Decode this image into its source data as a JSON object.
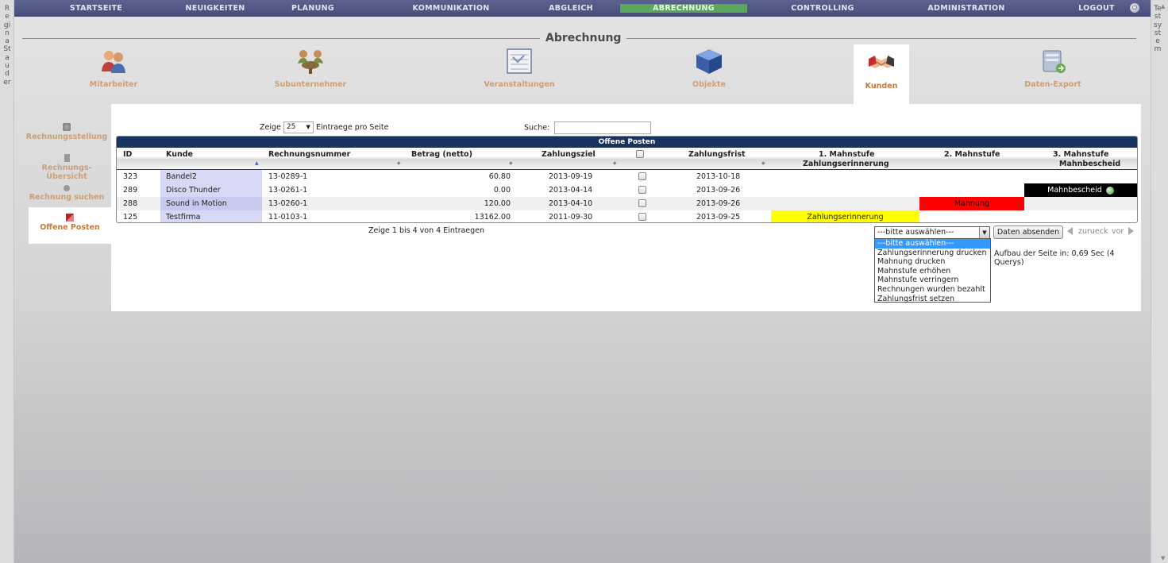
{
  "side": {
    "left_text": "Regina Stauder",
    "right_text": "Testsystem"
  },
  "nav": {
    "items": [
      "STARTSEITE",
      "NEUIGKEITEN",
      "PLANUNG",
      "KOMMUNIKATION",
      "ABGLEICH",
      "ABRECHNUNG",
      "CONTROLLING",
      "ADMINISTRATION",
      "LOGOUT"
    ],
    "active": "ABRECHNUNG",
    "active_color": "#5aa65a"
  },
  "section": {
    "title": "Abrechnung"
  },
  "modules": [
    {
      "label": "Mitarbeiter",
      "icon": "people-icon"
    },
    {
      "label": "Subunternehmer",
      "icon": "meeting-icon"
    },
    {
      "label": "Veranstaltungen",
      "icon": "schedule-icon"
    },
    {
      "label": "Objekte",
      "icon": "cube-icon"
    },
    {
      "label": "Kunden",
      "icon": "handshake-icon"
    },
    {
      "label": "Daten-Export",
      "icon": "export-icon"
    }
  ],
  "subnav": {
    "items": [
      "Rechnungsstellung",
      "Rechnungs-Übersicht",
      "Rechnung suchen",
      "Offene Posten"
    ],
    "active": "Offene Posten"
  },
  "controls": {
    "show_label": "Zeige",
    "page_size": "25",
    "per_page_label": "Eintraege pro Seite",
    "search_label": "Suche:",
    "search_value": ""
  },
  "table": {
    "caption": "Offene Posten",
    "headers": {
      "id": "ID",
      "kunde": "Kunde",
      "rechnungsnummer": "Rechnungsnummer",
      "betrag": "Betrag (netto)",
      "zahlungsziel": "Zahlungsziel",
      "zahlungsfrist": "Zahlungsfrist",
      "stufe1": "1. Mahnstufe",
      "stufe1_sub": "Zahlungserinnerung",
      "stufe2": "2. Mahnstufe",
      "stufe3": "3. Mahnstufe",
      "stufe3_sub": "Mahnbescheid"
    },
    "rows": [
      {
        "id": "323",
        "kunde": "Bandel2",
        "nr": "13-0289-1",
        "betrag": "60.80",
        "ziel": "2013-09-19",
        "frist": "2013-10-18",
        "m1": "",
        "m2": "",
        "m3": ""
      },
      {
        "id": "289",
        "kunde": "Disco Thunder",
        "nr": "13-0261-1",
        "betrag": "0.00",
        "ziel": "2013-04-14",
        "frist": "2013-09-26",
        "m1": "",
        "m2": "",
        "m3": "Mahnbescheid"
      },
      {
        "id": "288",
        "kunde": "Sound in Motion",
        "nr": "13-0260-1",
        "betrag": "120.00",
        "ziel": "2013-04-10",
        "frist": "2013-09-26",
        "m1": "",
        "m2": "Mahnung",
        "m3": ""
      },
      {
        "id": "125",
        "kunde": "Testfirma",
        "nr": "11-0103-1",
        "betrag": "13162.00",
        "ziel": "2011-09-30",
        "frist": "2013-09-25",
        "m1": "Zahlungserinnerung",
        "m2": "",
        "m3": ""
      }
    ],
    "colors": {
      "m1": "#ffff00",
      "m2": "#ff0000",
      "m3": "#000000",
      "header_bg": "#17335f",
      "kunde_bg": "#d6d8f5"
    }
  },
  "footer": {
    "info": "Zeige 1 bis 4 von 4 Eintraegen",
    "action_selected": "---bitte auswählen---",
    "action_options": [
      "---bitte auswählen---",
      "Zahlungserinnerung drucken",
      "Mahnung drucken",
      "Mahnstufe erhöhen",
      "Mahnstufe verringern",
      "Rechnungen wurden bezahlt",
      "Zahlungsfrist setzen"
    ],
    "submit_label": "Daten absenden",
    "prev_label": "zurueck",
    "next_label": "vor",
    "render_info": "Aufbau der Seite in: 0,69 Sec (4 Querys)"
  }
}
